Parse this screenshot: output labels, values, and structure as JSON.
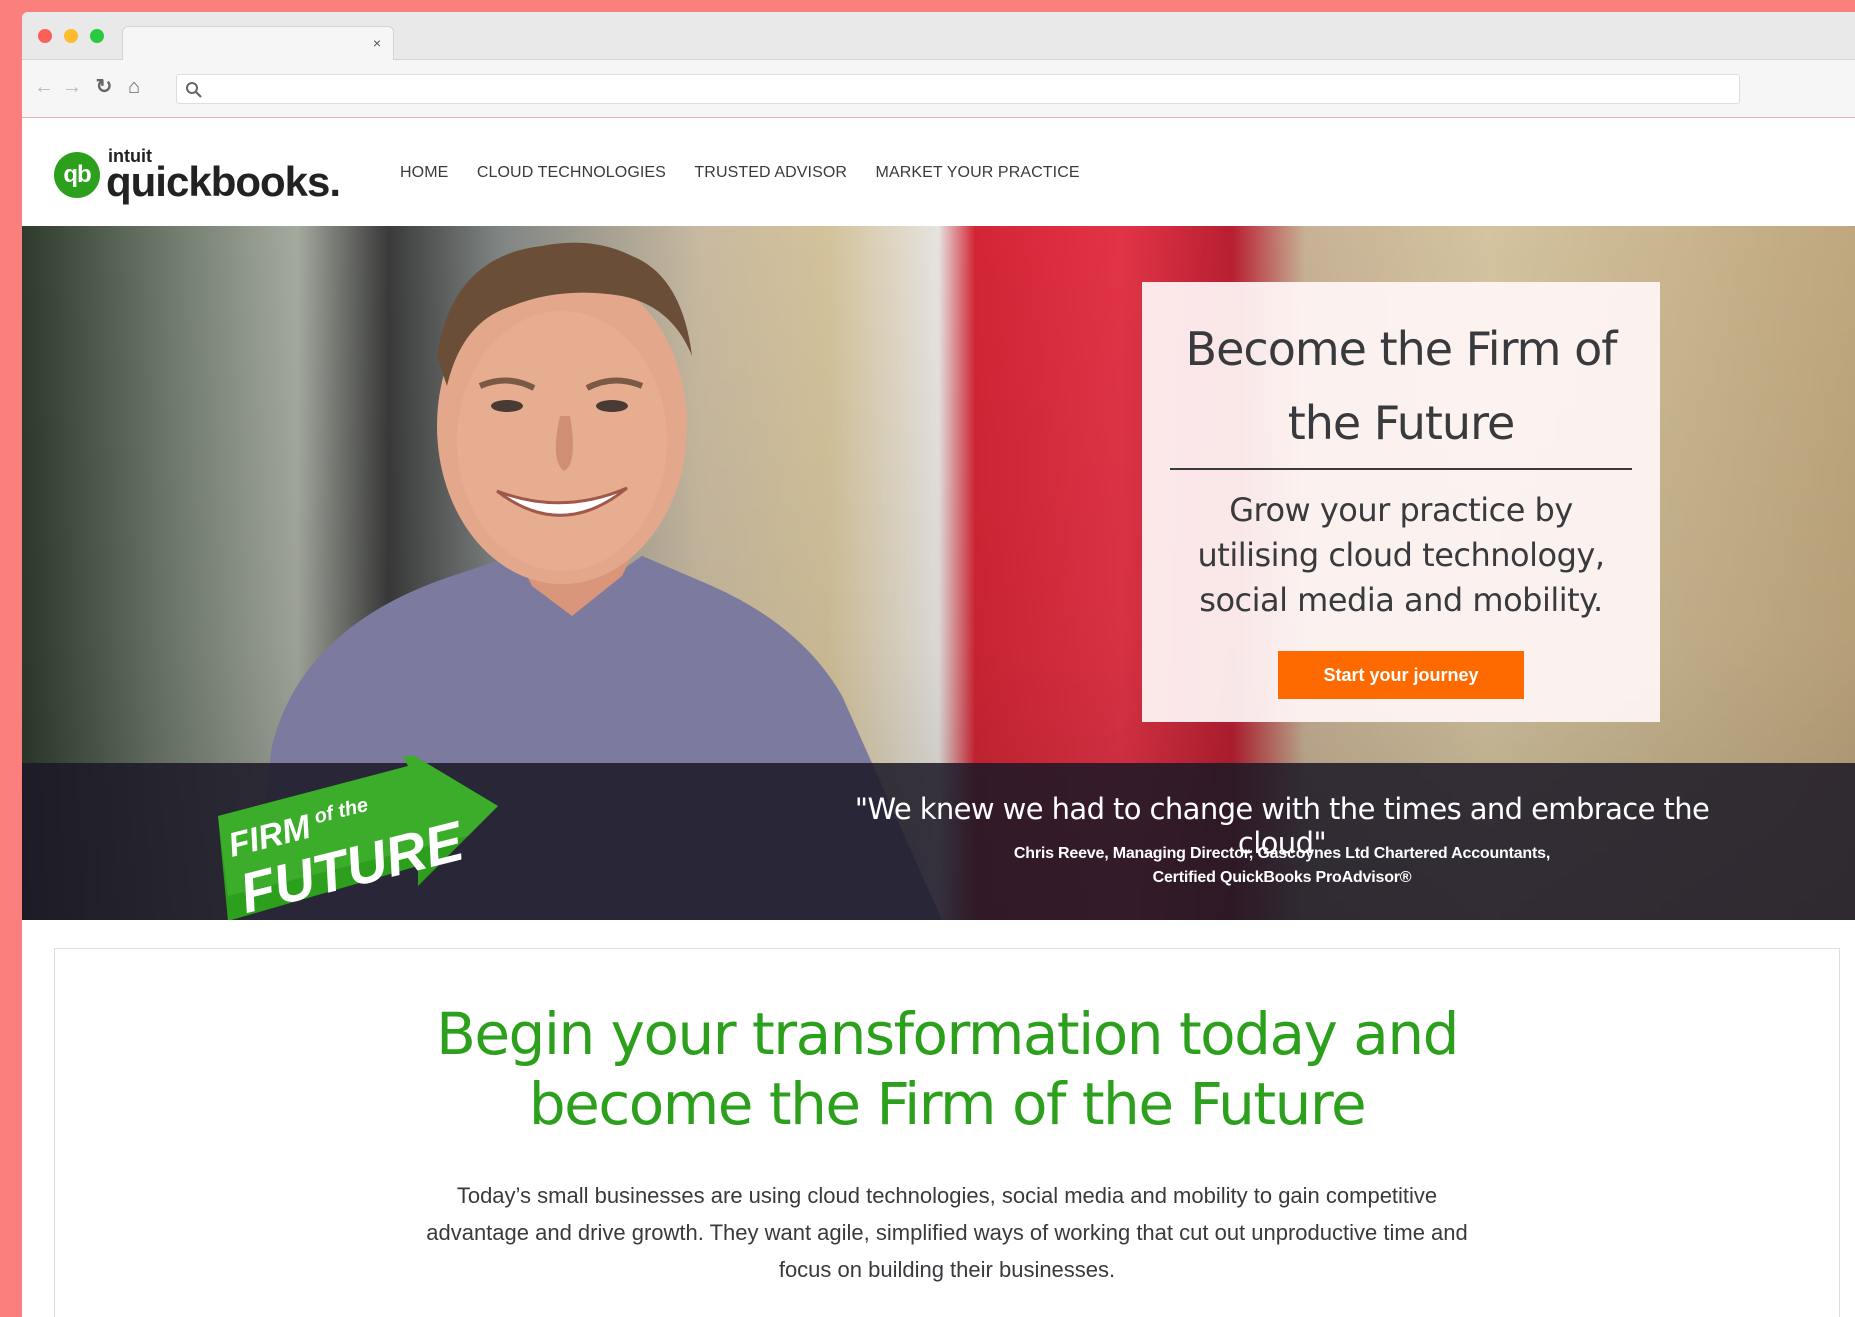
{
  "browser": {
    "tab_close": "×",
    "url": ""
  },
  "logo": {
    "intuit": "intuit",
    "wordmark": "quickbooks.",
    "mark": "qb"
  },
  "nav": {
    "items": [
      {
        "label": "HOME"
      },
      {
        "label": "CLOUD TECHNOLOGIES"
      },
      {
        "label": "TRUSTED ADVISOR"
      },
      {
        "label": "MARKET YOUR PRACTICE"
      }
    ]
  },
  "hero": {
    "promo_title": "Become the Firm of the Future",
    "promo_text": "Grow your practice by utilising cloud technology, social media and mobility.",
    "cta_label": "Start your journey",
    "badge": {
      "line1": "FIRM",
      "line1_small": "of the",
      "line2": "FUTURE"
    },
    "quote": "\"We knew we had to change with the times and embrace the cloud\"",
    "author_line1": "Chris Reeve, Managing Director, Gascoynes Ltd Chartered Accountants,",
    "author_line2": "Certified QuickBooks ProAdvisor®"
  },
  "content": {
    "heading": "Begin your transformation today and become the Firm of the Future",
    "text": "Today’s small businesses are using cloud technologies, social media and mobility to gain competitive advantage and drive growth. They want agile, simplified ways of working that cut out unproductive time and focus on building their businesses."
  },
  "colors": {
    "brand_green": "#2ca01c",
    "cta_orange": "#ff6a00",
    "page_background": "#fa7f7d",
    "text_dark": "#393a3d"
  }
}
